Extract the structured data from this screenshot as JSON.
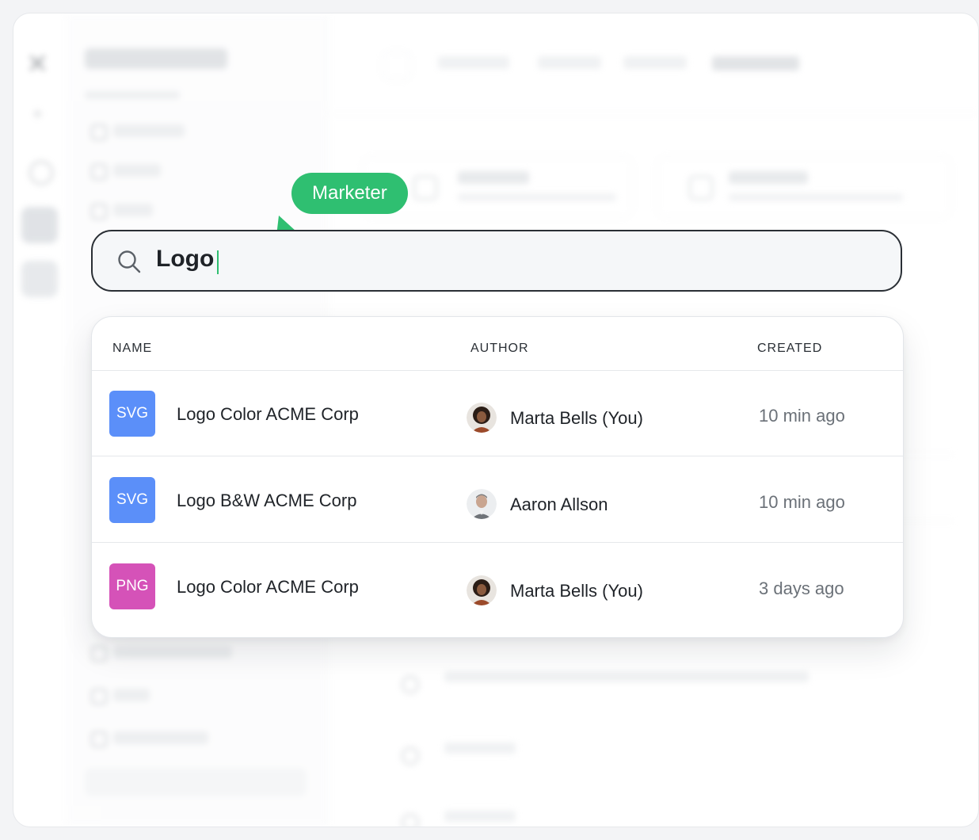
{
  "tooltip": {
    "label": "Marketer"
  },
  "search": {
    "query": "Logo"
  },
  "results": {
    "columns": {
      "name": "NAME",
      "author": "AUTHOR",
      "created": "CREATED"
    },
    "rows": [
      {
        "type": "SVG",
        "type_color": "#5b8ff9",
        "name": "Logo Color ACME Corp",
        "author": "Marta Bells (You)",
        "created": "10 min ago"
      },
      {
        "type": "SVG",
        "type_color": "#5b8ff9",
        "name": "Logo B&W ACME Corp",
        "author": "Aaron Allson",
        "created": "10 min ago"
      },
      {
        "type": "PNG",
        "type_color": "#d552b8",
        "name": "Logo Color ACME Corp",
        "author": "Marta Bells (You)",
        "created": "3 days ago"
      }
    ]
  },
  "colors": {
    "accent": "#2fbf71",
    "svg_badge": "#5b8ff9",
    "png_badge": "#d552b8"
  },
  "icons": {
    "search": "search-icon",
    "pointer": "cursor-pointer-icon"
  }
}
